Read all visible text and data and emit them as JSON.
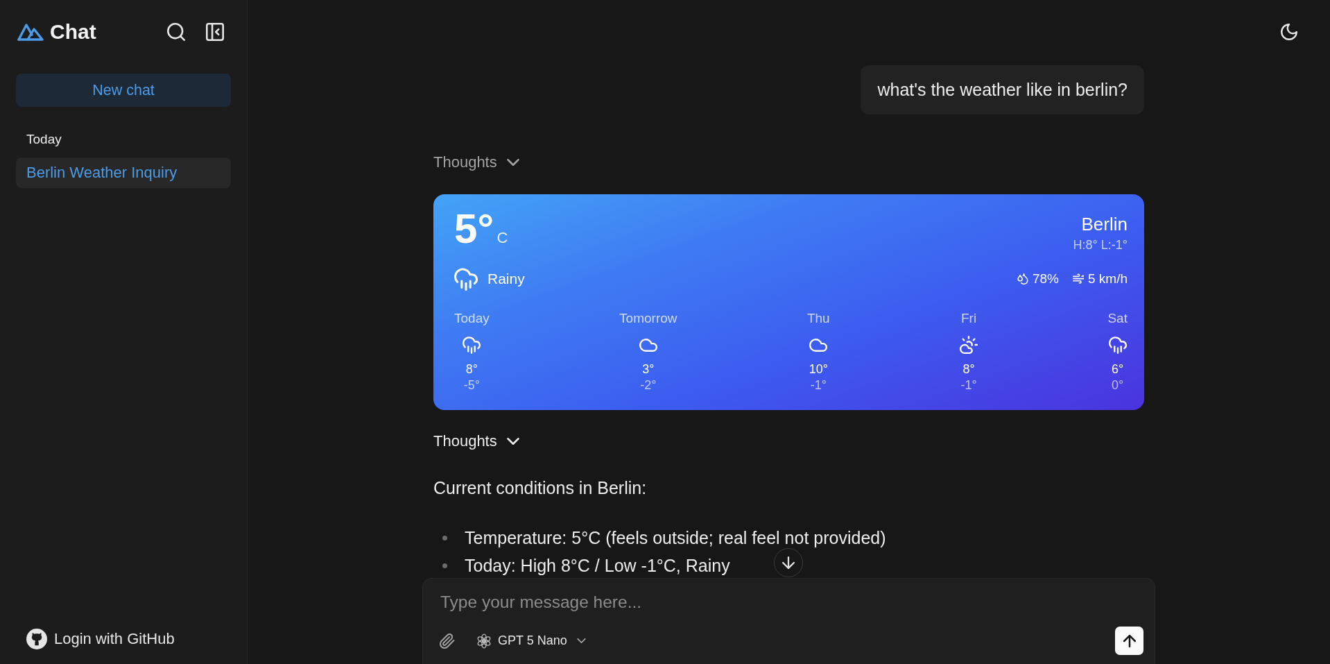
{
  "sidebar": {
    "app_name": "Chat",
    "new_chat_label": "New chat",
    "sections": [
      {
        "heading": "Today",
        "items": [
          {
            "title": "Berlin Weather Inquiry",
            "selected": true
          }
        ]
      }
    ],
    "login_label": "Login with GitHub"
  },
  "messages": [
    {
      "kind": "user",
      "text": "what's the weather like in berlin?"
    },
    {
      "kind": "thoughts",
      "label": "Thoughts",
      "expanded": false,
      "highlighted": false
    },
    {
      "kind": "weather",
      "temperature": "5°",
      "unit": "C",
      "city": "Berlin",
      "high_low": "H:8° L:-1°",
      "condition": {
        "kind": "rain",
        "label": "Rainy"
      },
      "humidity": "78%",
      "wind": "5 km/h",
      "forecast": [
        {
          "day": "Today",
          "kind": "rain",
          "high": "8°",
          "low": "-5°"
        },
        {
          "day": "Tomorrow",
          "kind": "cloud",
          "high": "3°",
          "low": "-2°"
        },
        {
          "day": "Thu",
          "kind": "cloud",
          "high": "10°",
          "low": "-1°"
        },
        {
          "day": "Fri",
          "kind": "partly-cloudy",
          "high": "8°",
          "low": "-1°"
        },
        {
          "day": "Sat",
          "kind": "rain",
          "high": "6°",
          "low": "0°"
        }
      ]
    },
    {
      "kind": "thoughts",
      "label": "Thoughts",
      "expanded": false,
      "highlighted": true
    },
    {
      "kind": "text",
      "paragraph": "Current conditions in Berlin:",
      "bullets": [
        "Temperature: 5°C (feels outside; real feel not provided)",
        "Today: High 8°C / Low -1°C, Rainy"
      ]
    }
  ],
  "composer": {
    "placeholder": "Type your message here...",
    "model": "GPT 5 Nano"
  }
}
